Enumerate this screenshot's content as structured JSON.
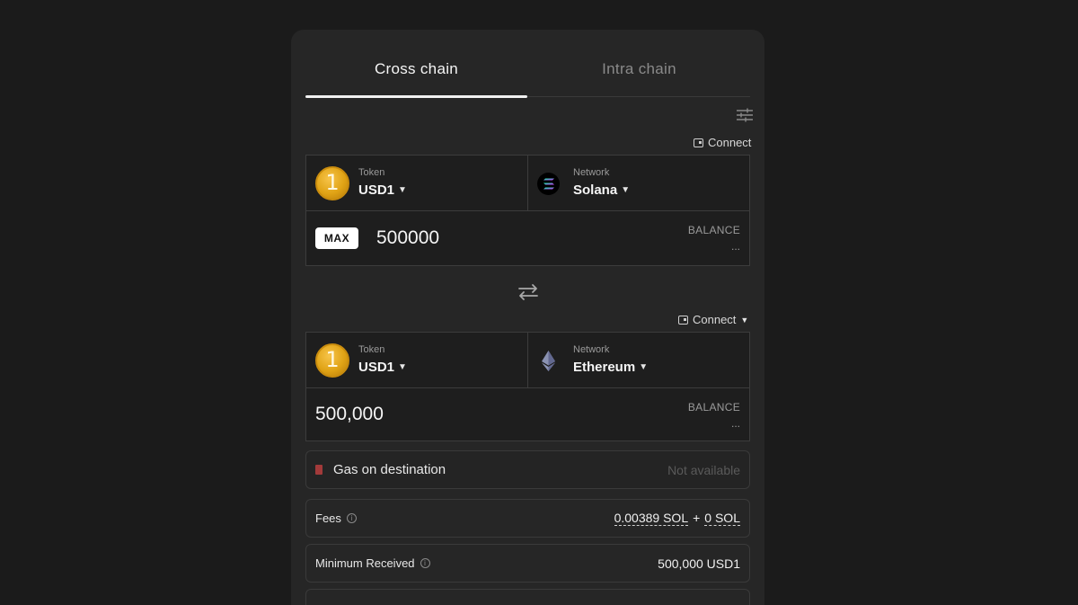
{
  "tabs": [
    {
      "label": "Cross chain",
      "active": true
    },
    {
      "label": "Intra chain",
      "active": false
    }
  ],
  "source": {
    "connect_label": "Connect",
    "token_label": "Token",
    "token_value": "USD1",
    "network_label": "Network",
    "network_value": "Solana",
    "max_label": "MAX",
    "amount": "500000",
    "balance_label": "BALANCE",
    "balance_value": "..."
  },
  "destination": {
    "connect_label": "Connect",
    "token_label": "Token",
    "token_value": "USD1",
    "network_label": "Network",
    "network_value": "Ethereum",
    "amount": "500,000",
    "balance_label": "BALANCE",
    "balance_value": "..."
  },
  "gas": {
    "label": "Gas on destination",
    "status": "Not available"
  },
  "fees": {
    "label": "Fees",
    "value_a": "0.00389 SOL",
    "plus": "+",
    "value_b": "0 SOL"
  },
  "minimum_received": {
    "label": "Minimum Received",
    "value": "500,000 USD1"
  },
  "icons": {
    "token": "usd1-coin-icon",
    "solana": "solana-logo-icon",
    "ethereum": "ethereum-logo-icon"
  },
  "colors": {
    "background": "#1b1b1b",
    "card": "#262626",
    "accent": "#ffffff",
    "coin": "#e0a315"
  }
}
